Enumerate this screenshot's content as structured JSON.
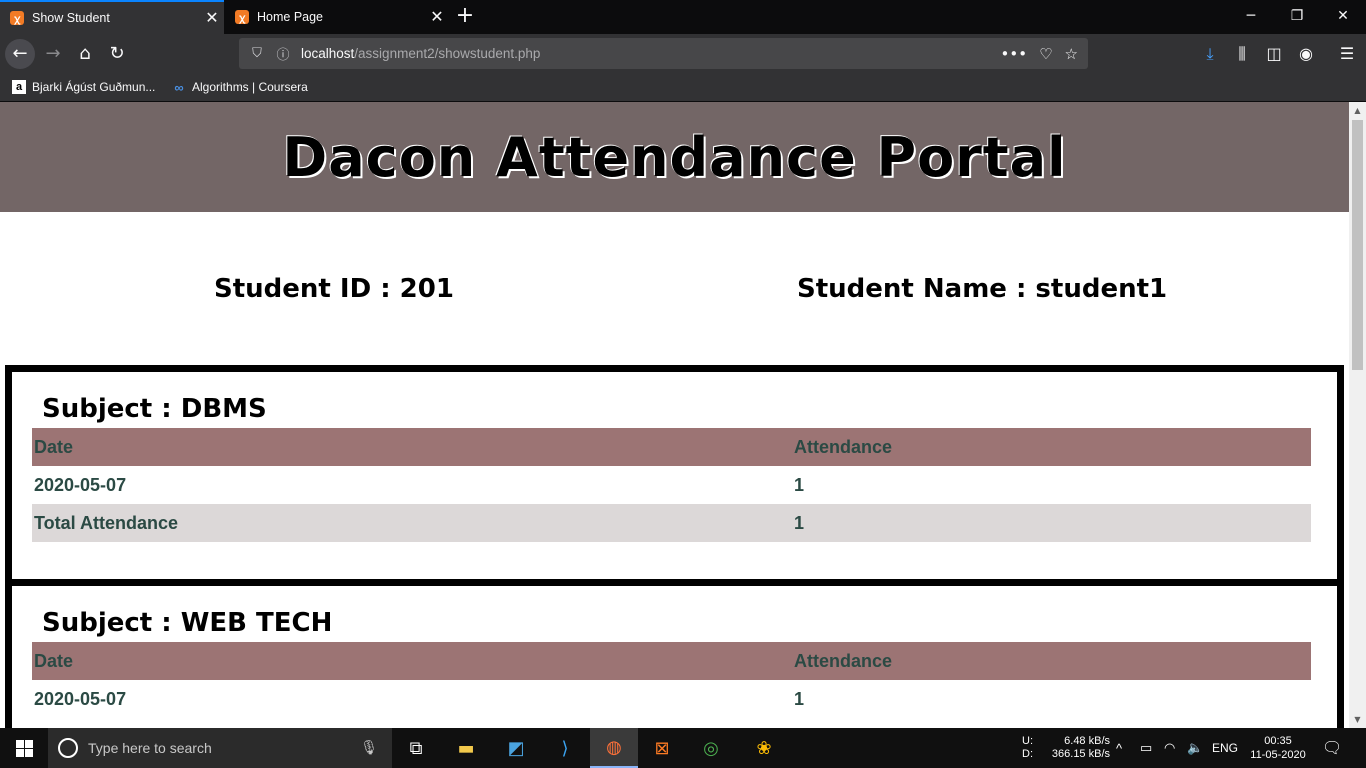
{
  "browser": {
    "tabs": [
      {
        "title": "Show Student",
        "active": true
      },
      {
        "title": "Home Page",
        "active": false
      }
    ],
    "url_host": "localhost",
    "url_path": "/assignment2/showstudent.php",
    "bookmarks": [
      {
        "label": "Bjarki Ágúst Guðmun...",
        "icon": "amazon-a-icon"
      },
      {
        "label": "Algorithms | Coursera",
        "icon": "coursera-icon"
      }
    ]
  },
  "page": {
    "title": "Dacon Attendance Portal",
    "student_id_text": "Student ID : 201",
    "student_name_text": "Student Name : student1",
    "subjects": [
      {
        "heading": "Subject : DBMS",
        "columns": [
          "Date",
          "Attendance"
        ],
        "rows": [
          [
            "2020-05-07",
            "1"
          ]
        ],
        "total_label": "Total Attendance",
        "total_value": "1"
      },
      {
        "heading": "Subject : WEB TECH",
        "columns": [
          "Date",
          "Attendance"
        ],
        "rows": [
          [
            "2020-05-07",
            "1"
          ]
        ]
      }
    ]
  },
  "taskbar": {
    "search_placeholder": "Type here to search",
    "net_up_label": "U:",
    "net_down_label": "D:",
    "net_up": "6.48 kB/s",
    "net_down": "366.15 kB/s",
    "lang": "ENG",
    "time": "00:35",
    "date": "11-05-2020"
  },
  "colors": {
    "header_bg": "#736666",
    "table_header_bg": "#9c7474",
    "total_row_bg": "#dcd8d8",
    "table_text": "#2b4a44"
  }
}
